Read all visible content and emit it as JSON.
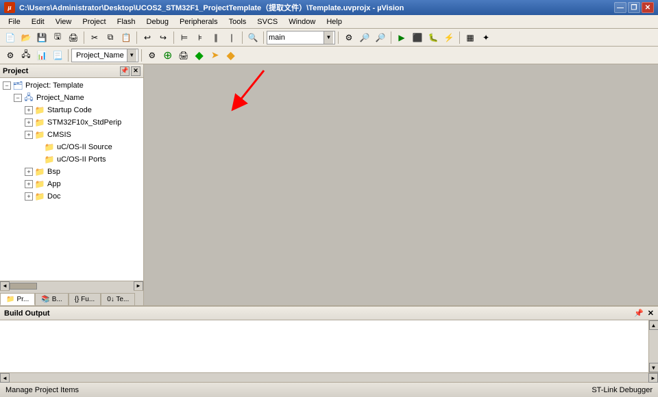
{
  "titlebar": {
    "icon_label": "µ",
    "title": "C:\\Users\\Administrator\\Desktop\\UCOS2_STM32F1_ProjectTemplate（提取文件）\\Template.uvprojx - µVision",
    "minimize": "—",
    "maximize": "❒",
    "close": "✕"
  },
  "menubar": {
    "items": [
      "File",
      "Edit",
      "View",
      "Project",
      "Flash",
      "Debug",
      "Peripherals",
      "Tools",
      "SVCS",
      "Window",
      "Help"
    ]
  },
  "toolbar1": {
    "buttons": [
      "📄",
      "📂",
      "💾",
      "✂",
      "⧉",
      "📋",
      "↩",
      "↪",
      "🔍",
      "🔎",
      "⚡",
      "⚙",
      "▶",
      "⏸",
      "⏹"
    ],
    "search_value": "main"
  },
  "toolbar2": {
    "project_name": "Project_Name"
  },
  "project_panel": {
    "title": "Project",
    "tree": [
      {
        "level": 0,
        "type": "root",
        "label": "Project: Template",
        "expanded": true
      },
      {
        "level": 1,
        "type": "group",
        "label": "Project_Name",
        "expanded": true
      },
      {
        "level": 2,
        "type": "folder",
        "label": "Startup Code",
        "expanded": false
      },
      {
        "level": 2,
        "type": "folder",
        "label": "STM32F10x_StdPerip",
        "expanded": false
      },
      {
        "level": 2,
        "type": "folder",
        "label": "CMSIS",
        "expanded": false
      },
      {
        "level": 3,
        "type": "folder",
        "label": "uC/OS-II Source",
        "expanded": false,
        "no_expander": true
      },
      {
        "level": 3,
        "type": "folder",
        "label": "uC/OS-II Ports",
        "expanded": false,
        "no_expander": true
      },
      {
        "level": 2,
        "type": "folder",
        "label": "Bsp",
        "expanded": false
      },
      {
        "level": 2,
        "type": "folder",
        "label": "App",
        "expanded": false
      },
      {
        "level": 2,
        "type": "folder",
        "label": "Doc",
        "expanded": false
      }
    ]
  },
  "panel_tabs": [
    {
      "label": "Pr...",
      "icon": "📁"
    },
    {
      "label": "B...",
      "icon": "📚"
    },
    {
      "label": "{}Fu...",
      "icon": ""
    },
    {
      "label": "0↓Te...",
      "icon": ""
    }
  ],
  "build_output": {
    "title": "Build Output"
  },
  "status_bar": {
    "left": "Manage Project Items",
    "right": "ST-Link Debugger"
  }
}
